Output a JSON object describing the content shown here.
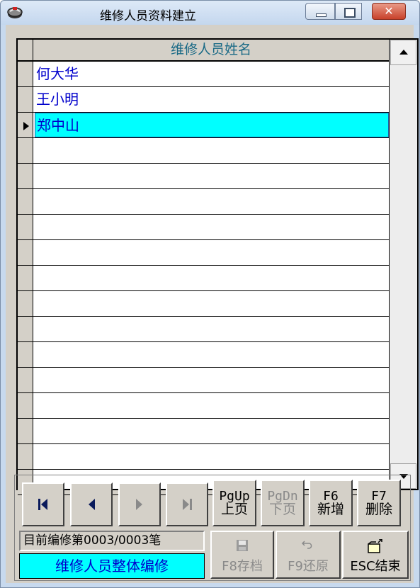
{
  "window": {
    "title": "维修人员资料建立",
    "close_glyph": "✕"
  },
  "grid": {
    "column_header": "维修人员姓名",
    "rows": [
      "何大华",
      "王小明",
      "郑中山",
      "",
      "",
      "",
      "",
      "",
      "",
      "",
      "",
      "",
      "",
      "",
      "",
      "",
      ""
    ],
    "selected_row": 2,
    "selection_color": "#00ffff",
    "text_color": "#0000cc"
  },
  "toolbar": {
    "nav": {
      "first_icon": "first-record-icon",
      "prev_icon": "prev-record-icon",
      "next_icon": "next-record-icon",
      "last_icon": "last-record-icon"
    },
    "pgup": {
      "key": "PgUp",
      "label": "上页"
    },
    "pgdn": {
      "key": "PgDn",
      "label": "下页"
    },
    "f6": {
      "key": "F6",
      "label": "新增"
    },
    "f7": {
      "key": "F7",
      "label": "删除"
    },
    "record_status": "目前编修第0003/0003笔",
    "mode": "维修人员整体编修",
    "f8": {
      "label": "F8存档",
      "icon": "floppy-disk-icon"
    },
    "f9": {
      "label": "F9还原",
      "icon": "undo-icon"
    },
    "esc": {
      "label": "ESC结束",
      "icon": "exit-folder-icon"
    }
  }
}
